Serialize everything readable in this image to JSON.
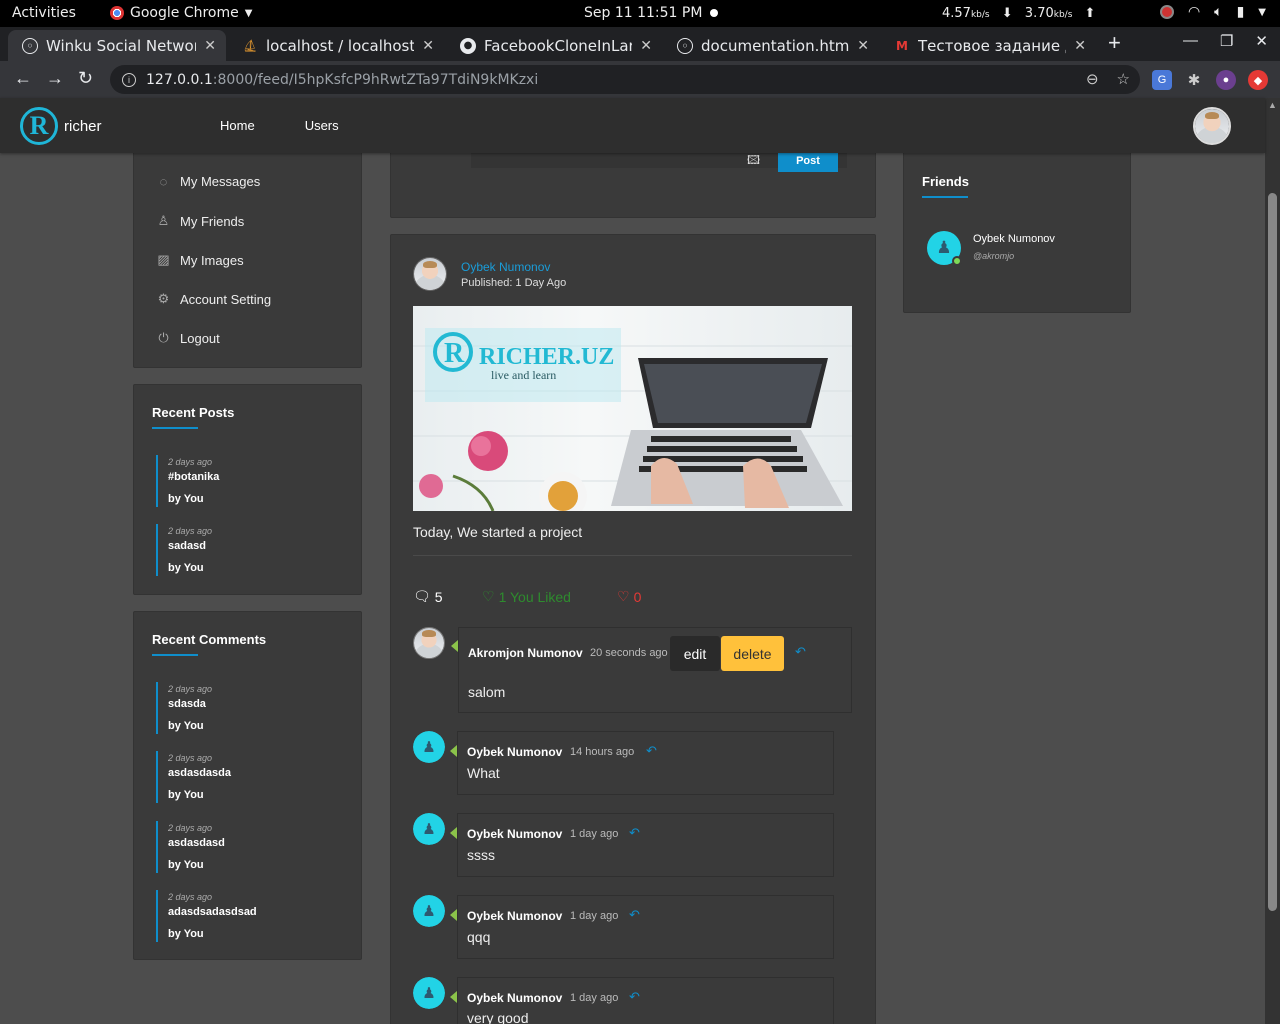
{
  "os": {
    "activities": "Activities",
    "app_name": "Google Chrome",
    "clock": "Sep 11  11:51 PM",
    "net_down": "4.57",
    "net_up": "3.70",
    "net_unit": "kb/s"
  },
  "browser": {
    "tabs": [
      {
        "title": "Winku Social Network",
        "icon": "globe-icon",
        "active": true
      },
      {
        "title": "localhost / localhost / l",
        "icon": "phpmyadmin-icon",
        "active": false
      },
      {
        "title": "FacebookCloneInLarav",
        "icon": "github-icon",
        "active": false
      },
      {
        "title": "documentation.html",
        "icon": "globe-icon",
        "active": false
      },
      {
        "title": "Тестовое задание для",
        "icon": "gmail-icon",
        "active": false
      }
    ],
    "url_host": "127.0.0.1",
    "url_path": ":8000/feed/I5hpKsfcP9hRwtZTa97TdiN9kMKzxi"
  },
  "site": {
    "logo_text": "richer",
    "logo_letter": "R",
    "nav": [
      "Home",
      "Users"
    ]
  },
  "side_menu": [
    {
      "label": "My Messages",
      "icon": "message-icon"
    },
    {
      "label": "My Friends",
      "icon": "user-icon"
    },
    {
      "label": "My Images",
      "icon": "image-icon"
    },
    {
      "label": "Account Setting",
      "icon": "gear-icon"
    },
    {
      "label": "Logout",
      "icon": "power-icon"
    }
  ],
  "recent_posts": {
    "title": "Recent Posts",
    "items": [
      {
        "when": "2 days ago",
        "title": "#botanika",
        "by": "by You"
      },
      {
        "when": "2 days ago",
        "title": "sadasd",
        "by": "by You"
      }
    ]
  },
  "recent_comments": {
    "title": "Recent Comments",
    "items": [
      {
        "when": "2 days ago",
        "title": "sdasda",
        "by": "by You"
      },
      {
        "when": "2 days ago",
        "title": "asdasdasda",
        "by": "by You"
      },
      {
        "when": "2 days ago",
        "title": "asdasdasd",
        "by": "by You"
      },
      {
        "when": "2 days ago",
        "title": "adasdsadasdsad",
        "by": "by You"
      }
    ]
  },
  "composer": {
    "post_label": "Post"
  },
  "post": {
    "author": "Oybek Numonov",
    "published": "Published: 1 Day Ago",
    "image_brand": "RICHER.UZ",
    "image_tagline": "live and learn",
    "text": "Today, We started a project",
    "comments_count": "5",
    "likes_label": "1 You Liked",
    "dislikes": "0"
  },
  "comments": [
    {
      "name": "Akromjon Numonov",
      "time": "20 seconds ago",
      "text": "salom",
      "own": true,
      "edit_label": "edit",
      "delete_label": "delete"
    },
    {
      "name": "Oybek Numonov",
      "time": "14 hours ago",
      "text": "What"
    },
    {
      "name": "Oybek Numonov",
      "time": "1 day ago",
      "text": "ssss"
    },
    {
      "name": "Oybek Numonov",
      "time": "1 day ago",
      "text": "qqq"
    },
    {
      "name": "Oybek Numonov",
      "time": "1 day ago",
      "text": "very good"
    }
  ],
  "friends": {
    "title": "Friends",
    "items": [
      {
        "name": "Oybek Numonov",
        "handle": "@akromjo",
        "online": true
      }
    ]
  },
  "colors": {
    "accent": "#0f8ecb",
    "logo_cyan": "#1fb6d8",
    "delete_yellow": "#ffc13b",
    "like_green": "#2e8b2e",
    "dislike_red": "#e53935",
    "page_bg": "#4d4d4d",
    "panel_bg": "#3a3a3a"
  }
}
